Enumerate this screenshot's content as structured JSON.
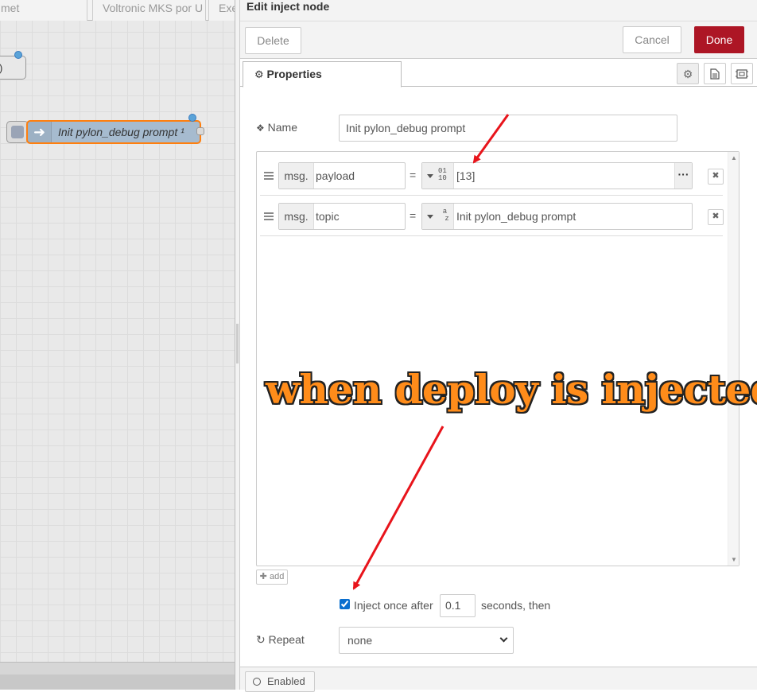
{
  "workspace": {
    "tabs": [
      "met",
      "Voltronic MKS por U",
      "Exe"
    ],
    "partial_node_label": ")",
    "inject_node_label": "Init pylon_debug prompt ¹"
  },
  "tray": {
    "title": "Edit inject node",
    "delete_label": "Delete",
    "cancel_label": "Cancel",
    "done_label": "Done",
    "properties_tab_label": "Properties",
    "name_label": "Name",
    "name_value": "Init pylon_debug prompt",
    "props": [
      {
        "prefix": "msg.",
        "property": "payload",
        "type_glyph": "01\n10",
        "value": "[13]"
      },
      {
        "prefix": "msg.",
        "property": "topic",
        "type_glyph": "a\nz",
        "value": "Init pylon_debug prompt"
      }
    ],
    "add_label": "add",
    "inject_once_label": "Inject once after",
    "inject_once_checked": true,
    "inject_delay": "0.1",
    "seconds_then_label": "seconds, then",
    "repeat_label": "Repeat",
    "repeat_value": "none",
    "enabled_label": "Enabled"
  },
  "annotation": {
    "text": "when deploy is injected",
    "text_color": "#ff8c1a",
    "arrow_color": "#e8141b"
  },
  "colors": {
    "done_button": "#ad1625",
    "node_fill": "#a6bbcf",
    "node_selected_border": "#ff7f0e",
    "port": "#5aa3d8"
  }
}
